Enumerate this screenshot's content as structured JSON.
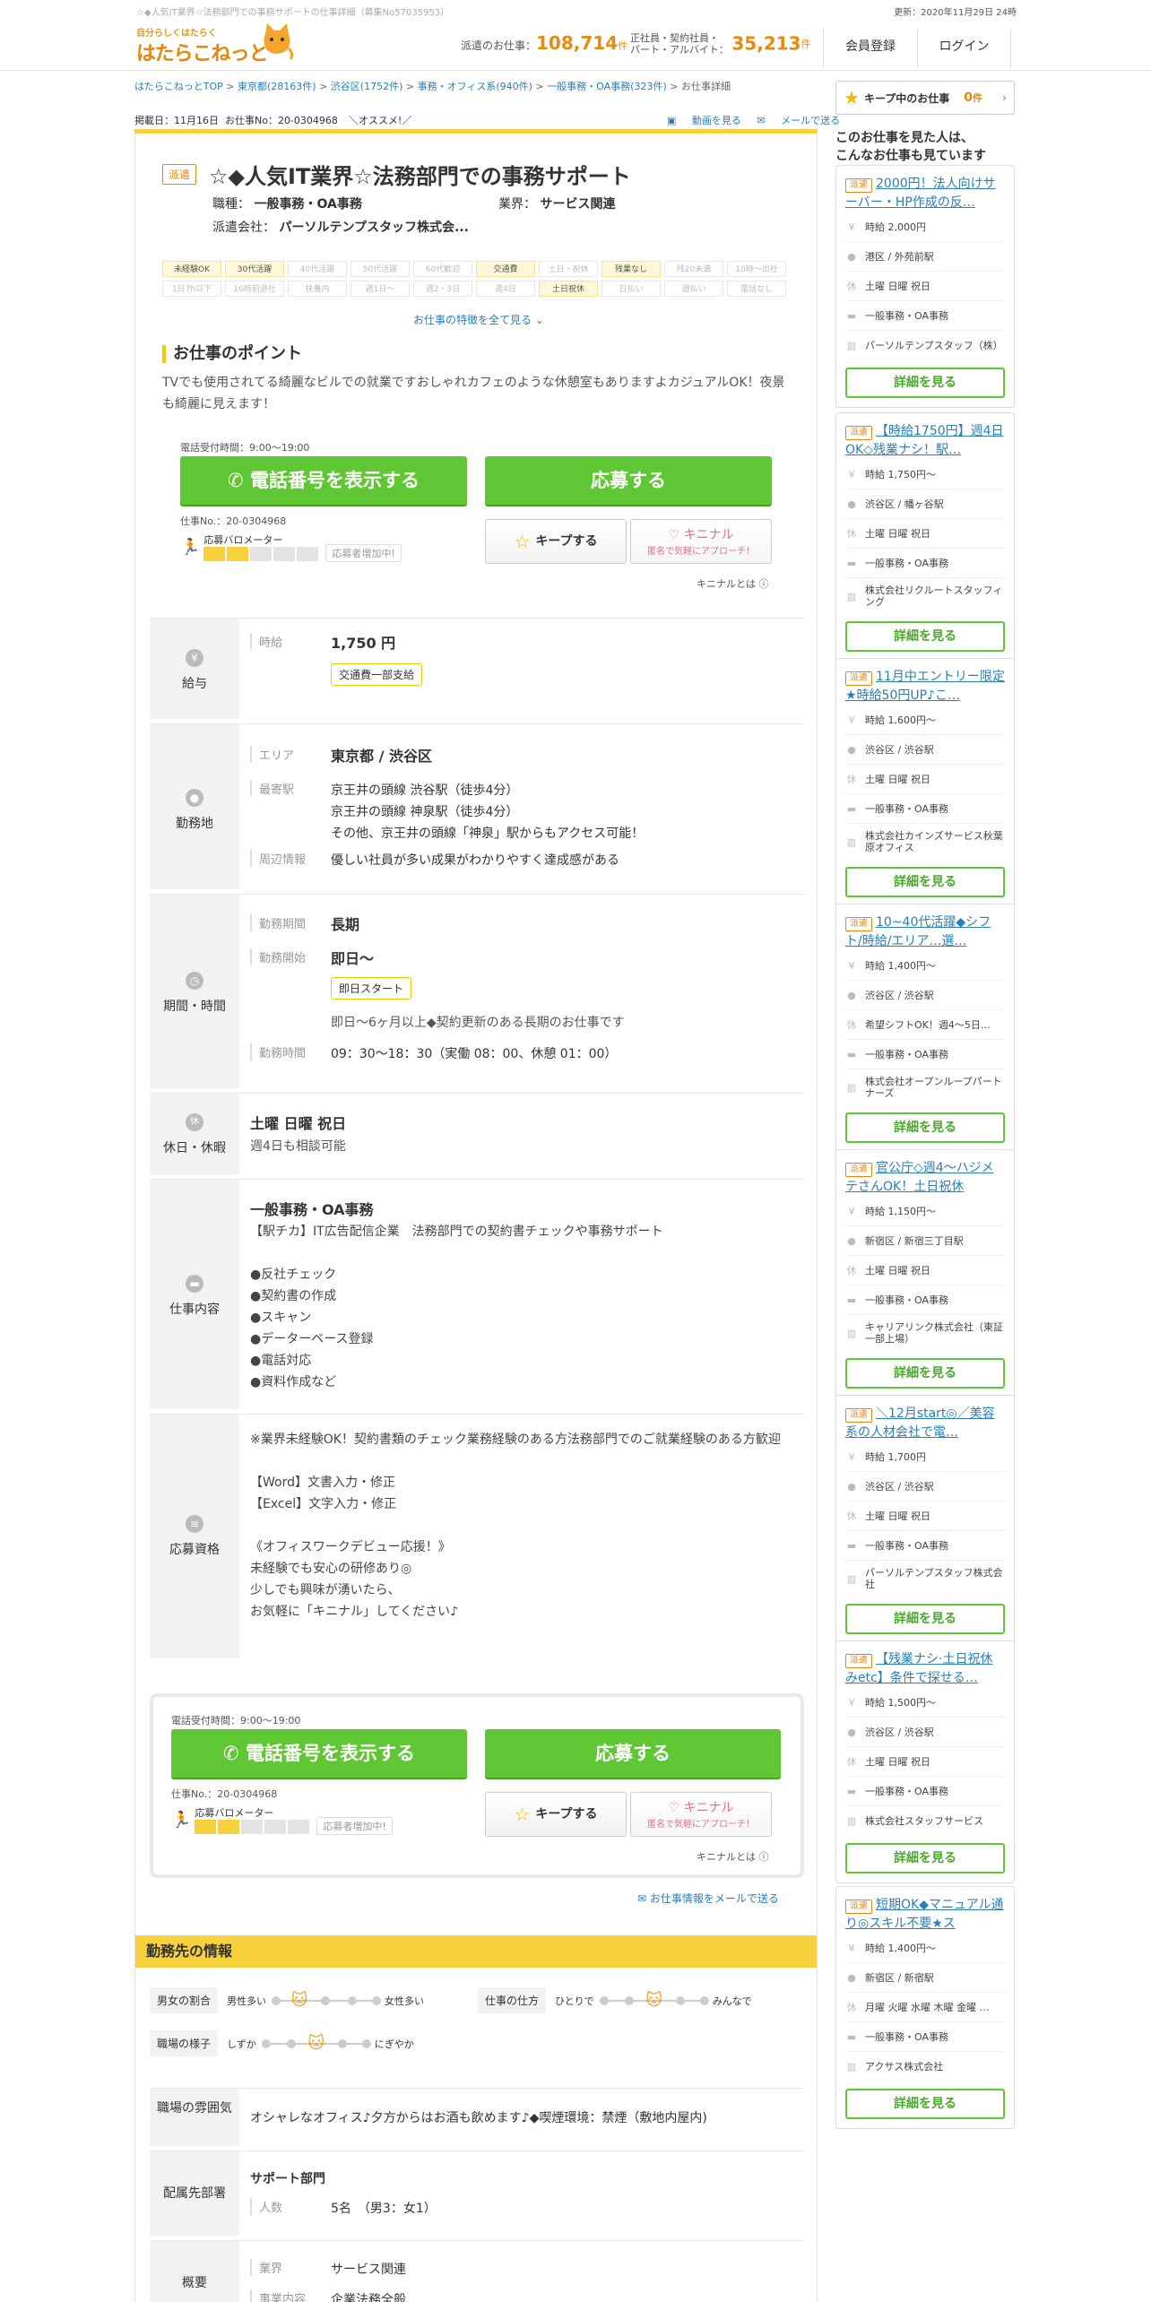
{
  "header": {
    "tagline": "☆◆人気IT業界☆法務部門での事務サポートの仕事詳細（募集No57035953）",
    "update": "更新：2020年11月29日 24時",
    "logo_small": "自分らしくはたらく",
    "logo_big": "はたらこねっと",
    "stat1_label": "派遣のお仕事：",
    "stat1_value": "108,714",
    "stat1_unit": "件",
    "stat2_label1": "正社員・契約社員・",
    "stat2_label2": "パート・アルバイト：",
    "stat2_value": "35,213",
    "stat2_unit": "件",
    "register": "会員登録",
    "login": "ログイン"
  },
  "breadcrumb": [
    "はたらこねっとTOP",
    "東京都(28163件)",
    "渋谷区(1752件)",
    "事務・オフィス系(940件)",
    "一般事務・OA事務(323件)",
    "お仕事詳細"
  ],
  "keep": {
    "label": "キープ中のお仕事",
    "count": "0",
    "unit": "件"
  },
  "posted": {
    "date": "掲載日：11月16日",
    "no": "お仕事No：20-0304968",
    "rec": "＼オススメ!／",
    "video": "動画を見る",
    "mail": "メールで送る"
  },
  "job": {
    "tag": "派遣",
    "title": "☆◆人気IT業界☆法務部門での事務サポート",
    "shokushu_label": "職種：",
    "shokushu": "一般事務・OA事務",
    "gyokai_label": "業界：",
    "gyokai": "サービス関連",
    "company_label": "派遣会社：",
    "company": "パーソルテンプスタッフ株式会..."
  },
  "tags": [
    {
      "t": "未経験OK",
      "on": true
    },
    {
      "t": "30代活躍",
      "on": true
    },
    {
      "t": "40代活躍",
      "on": false
    },
    {
      "t": "50代活躍",
      "on": false
    },
    {
      "t": "60代歓迎",
      "on": false
    },
    {
      "t": "交通費",
      "on": true
    },
    {
      "t": "土日・祝休",
      "on": false
    },
    {
      "t": "残業なし",
      "on": true
    },
    {
      "t": "残20未満",
      "on": false
    },
    {
      "t": "10時～出社",
      "on": false
    },
    {
      "t": "1日7h以下",
      "on": false
    },
    {
      "t": "16時前退社",
      "on": false
    },
    {
      "t": "扶養内",
      "on": false
    },
    {
      "t": "週1日～",
      "on": false
    },
    {
      "t": "週2・3日",
      "on": false
    },
    {
      "t": "週4日",
      "on": false
    },
    {
      "t": "土日祝休",
      "on": true
    },
    {
      "t": "日払い",
      "on": false
    },
    {
      "t": "週払い",
      "on": false
    },
    {
      "t": "電話なし",
      "on": false
    }
  ],
  "tags_more": "お仕事の特徴を全て見る ⌄",
  "point": {
    "heading": "お仕事のポイント",
    "text": "TVでも使用されてる綺麗なビルでの就業ですおしゃれカフェのような休憩室もありますよカジュアルOK！夜景も綺麗に見えます！"
  },
  "action": {
    "phone_time": "電話受付時間：9:00～19:00",
    "phone_btn": "電話番号を表示する",
    "apply_btn": "応募する",
    "job_no": "仕事No.：20-0304968",
    "meter_label": "応募バロメーター",
    "meter_fill": 2,
    "meter_total": 5,
    "meter_pill": "応募者増加中!",
    "keep_btn": "キープする",
    "kin_btn": "キニナル",
    "kin_sub": "匿名で気軽にアプローチ！",
    "kin_about": "キニナルとは"
  },
  "salary": {
    "head": "給与",
    "icon": "¥",
    "k": "時給",
    "v": "1,750 円",
    "tag": "交通費一部支給"
  },
  "location": {
    "head": "勤務地",
    "area_k": "エリア",
    "area_v": "東京都 / 渋谷区",
    "station_k": "最寄駅",
    "station_v1": "京王井の頭線 渋谷駅（徒歩4分）",
    "station_v2": "京王井の頭線 神泉駅（徒歩4分）",
    "station_v3": "その他、京王井の頭線「神泉」駅からもアクセス可能！",
    "near_k": "周辺情報",
    "near_v": "優しい社員が多い成果がわかりやすく達成感がある"
  },
  "period": {
    "head": "期間・時間",
    "term_k": "勤務期間",
    "term_v": "長期",
    "start_k": "勤務開始",
    "start_v": "即日～",
    "start_tag": "即日スタート",
    "start_note": "即日～6ヶ月以上◆契約更新のある長期のお仕事です",
    "time_k": "勤務時間",
    "time_v": "09：30～18：30（実働 08：00、休憩 01：00）"
  },
  "holiday": {
    "head": "休日・休暇",
    "icon": "休",
    "v": "土曜 日曜 祝日",
    "note": "週4日も相談可能"
  },
  "work": {
    "head": "仕事内容",
    "title": "一般事務・OA事務",
    "lines": [
      "【駅チカ】IT広告配信企業　法務部門での契約書チェックや事務サポート",
      "",
      "●反社チェック",
      "●契約書の作成",
      "●スキャン",
      "●データーベース登録",
      "●電話対応",
      "●資料作成など"
    ]
  },
  "qual": {
    "head": "応募資格",
    "lines": [
      "※業界未経験OK！契約書類のチェック業務経験のある方法務部門でのご就業経験のある方歓迎",
      "",
      "【Word】文書入力・修正",
      "【Excel】文字入力・修正",
      "",
      "《オフィスワークデビュー応援！》",
      "未経験でも安心の研修あり◎",
      "少しでも興味が湧いたら、",
      "お気軽に「キニナル」してください♪"
    ]
  },
  "mail_link": "お仕事情報をメールで送る",
  "workplace": {
    "heading": "勤務先の情報",
    "ratio_label": "男女の割合",
    "ratio_left": "男性多い",
    "ratio_right": "女性多い",
    "style_label": "仕事の仕方",
    "style_left": "ひとりで",
    "style_right": "みんなで",
    "mood_label": "職場の様子",
    "mood_left": "しずか",
    "mood_right": "にぎやか",
    "atmos_head": "職場の雰囲気",
    "atmos_v": "オシャレなオフィス♪夕方からはお酒も飲めます♪◆喫煙環境：禁煙（敷地内屋内)",
    "dept_head": "配属先部署",
    "dept_v": "サポート部門",
    "people_k": "人数",
    "people_v": "5名　（男3：女1）",
    "overview_head": "概要",
    "ind_k": "業界",
    "ind_v": "サービス関連",
    "biz_k": "事業内容",
    "biz_v": "企業法務全般"
  },
  "sidebar": {
    "heading1": "このお仕事を見た人は、",
    "heading2": "こんなお仕事も見ています",
    "detail_btn": "詳細を見る",
    "cards": [
      {
        "tag": "派遣",
        "title": "2000円！法人向けサーバー・HP作成の反…",
        "wage": "時給 2,000円",
        "loc": "港区 / 外苑前駅",
        "days": "土曜 日曜 祝日",
        "job": "一般事務・OA事務",
        "co": "パーソルテンプスタッフ（株）"
      },
      {
        "tag": "派遣",
        "title": "【時給1750円】週4日OK◇残業ナシ！駅…",
        "wage": "時給 1,750円～",
        "loc": "渋谷区 / 幡ヶ谷駅",
        "days": "土曜 日曜 祝日",
        "job": "一般事務・OA事務",
        "co": "株式会社リクルートスタッフィング"
      },
      {
        "tag": "派遣",
        "title": "11月中エントリー限定★時給50円UP♪こ…",
        "wage": "時給 1,600円～",
        "loc": "渋谷区 / 渋谷駅",
        "days": "土曜 日曜 祝日",
        "job": "一般事務・OA事務",
        "co": "株式会社カインズサービス秋葉原オフィス"
      },
      {
        "tag": "派遣",
        "title": "10~40代活躍◆シフト/時給/エリア…選…",
        "wage": "時給 1,400円～",
        "loc": "渋谷区 / 渋谷駅",
        "days": "希望シフトOK！週4～5日…",
        "job": "一般事務・OA事務",
        "co": "株式会社オープンループパートナーズ"
      },
      {
        "tag": "派遣",
        "title": "官公庁◇週4～ハジメテさんOK！土日祝休",
        "wage": "時給 1,150円～",
        "loc": "新宿区 / 新宿三丁目駅",
        "days": "土曜 日曜 祝日",
        "job": "一般事務・OA事務",
        "co": "キャリアリンク株式会社（東証一部上場）"
      },
      {
        "tag": "派遣",
        "title": "＼12月start◎／美容系の人材会社で電…",
        "wage": "時給 1,700円",
        "loc": "渋谷区 / 渋谷駅",
        "days": "土曜 日曜 祝日",
        "job": "一般事務・OA事務",
        "co": "パーソルテンプスタッフ株式会社"
      },
      {
        "tag": "派遣",
        "title": "【残業ナシ·土日祝休みetc】条件で探せる…",
        "wage": "時給 1,500円～",
        "loc": "渋谷区 / 渋谷駅",
        "days": "土曜 日曜 祝日",
        "job": "一般事務・OA事務",
        "co": "株式会社スタッフサービス"
      },
      {
        "tag": "派遣",
        "title": "短期OK◆マニュアル通り◎スキル不要★ス",
        "wage": "時給 1,400円～",
        "loc": "新宿区 / 新宿駅",
        "days": "月曜 火曜 水曜 木曜 金曜 …",
        "job": "一般事務・OA事務",
        "co": "アクサス株式会社"
      }
    ]
  }
}
